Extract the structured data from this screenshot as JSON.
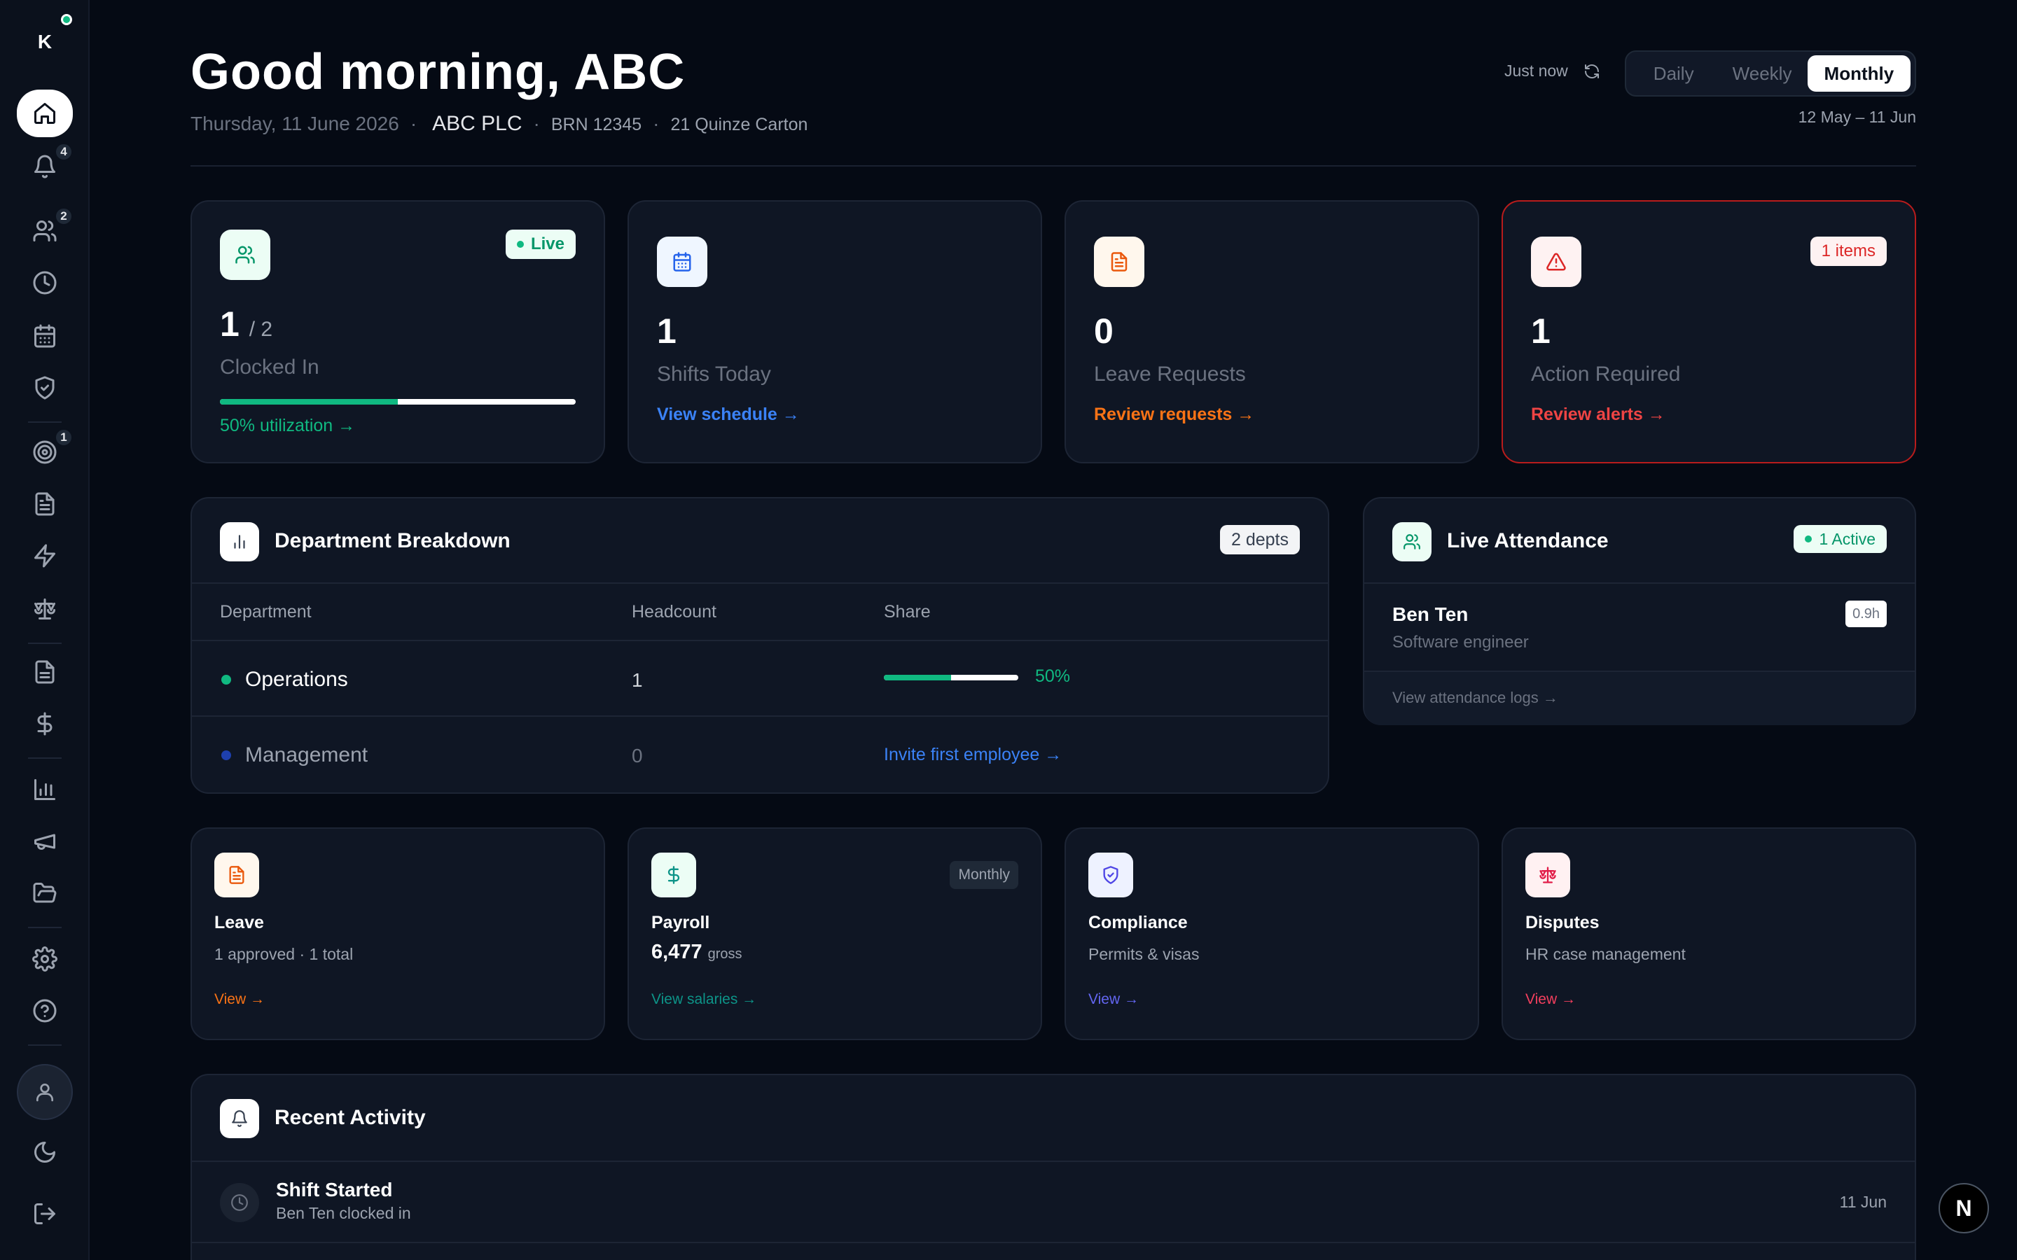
{
  "sidebar": {
    "logo": "K",
    "badges": {
      "notifications": "4",
      "team": "2",
      "goals": "1"
    }
  },
  "header": {
    "greeting": "Good morning, ABC",
    "date": "Thursday, 11 June 2026",
    "company": "ABC PLC",
    "brn": "BRN 12345",
    "address": "21 Quinze Carton",
    "refresh_status": "Just now",
    "periods": [
      "Daily",
      "Weekly",
      "Monthly"
    ],
    "selected_period": "Monthly",
    "date_range": "12 May – 11 Jun"
  },
  "stats": {
    "clocked_in": {
      "value": "1",
      "of": "/ 2",
      "label": "Clocked In",
      "badge": "Live",
      "link": "50% utilization →",
      "utilization": 0.5
    },
    "shifts": {
      "value": "1",
      "label": "Shifts Today",
      "link": "View schedule →"
    },
    "leave": {
      "value": "0",
      "label": "Leave Requests",
      "link": "Review requests →"
    },
    "action": {
      "value": "1",
      "label": "Action Required",
      "badge": "1 items",
      "link": "Review alerts →"
    }
  },
  "departments": {
    "title": "Department Breakdown",
    "badge": "2 depts",
    "columns": [
      "Department",
      "Headcount",
      "Share"
    ],
    "rows": [
      {
        "name": "Operations",
        "headcount": "1",
        "share": "50%",
        "share_value": 0.5
      },
      {
        "name": "Management",
        "headcount": "0",
        "invite": "Invite first employee →"
      }
    ]
  },
  "attendance": {
    "title": "Live Attendance",
    "badge": "1 Active",
    "employee": {
      "name": "Ben Ten",
      "role": "Software engineer",
      "hours": "0.9h"
    },
    "link": "View attendance logs →"
  },
  "modules": {
    "leave": {
      "title": "Leave",
      "sub": "1 approved · 1 total",
      "link": "View →"
    },
    "payroll": {
      "title": "Payroll",
      "badge": "Monthly",
      "amount": "6,477",
      "amount_unit": "gross",
      "link": "View salaries →"
    },
    "compliance": {
      "title": "Compliance",
      "sub": "Permits & visas",
      "link": "View →"
    },
    "disputes": {
      "title": "Disputes",
      "sub": "HR case management",
      "link": "View →"
    }
  },
  "activity": {
    "title": "Recent Activity",
    "items": [
      {
        "title": "Shift Started",
        "desc": "Ben Ten clocked in",
        "date": "11 Jun"
      }
    ]
  },
  "fab": "N",
  "colors": {
    "accent_green": "#10b981",
    "accent_blue": "#3b82f6",
    "accent_orange": "#f97316",
    "alert_red": "#dc2626"
  }
}
